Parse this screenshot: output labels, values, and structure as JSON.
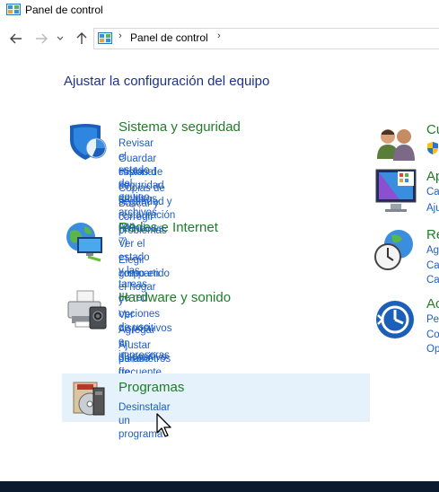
{
  "window": {
    "title": "Panel de control"
  },
  "address_bar": {
    "breadcrumb": "Panel de control"
  },
  "heading": "Ajustar la configuración del equipo",
  "categories": [
    {
      "title": "Sistema y seguridad",
      "links": [
        "Revisar el estado del equipo",
        "Guardar copias de seguridad de los archivos con",
        "Historial de archivos",
        "Copias de seguridad y restauración (Windows 7)",
        "Buscar y corregir problemas"
      ]
    },
    {
      "title": "Redes e Internet",
      "links": [
        "Ver el estado y las tareas de red",
        "Elegir grupo en el hogar y opciones de uso",
        "compartido"
      ]
    },
    {
      "title": "Hardware y sonido",
      "links": [
        "Ver dispositivos e impresoras",
        "Agregar un dispositivo",
        "Ajustar parámetros de configuración de movilidad",
        "de uso frecuente"
      ]
    },
    {
      "title": "Programas",
      "links": [
        "Desinstalar un programa"
      ]
    }
  ],
  "right_categories": [
    {
      "title": "Cu",
      "links": []
    },
    {
      "title": "Ap",
      "links": [
        "Ca",
        "Aju"
      ]
    },
    {
      "title": "Re",
      "links": [
        "Ag",
        "Ca",
        "Ca"
      ]
    },
    {
      "title": "Ac",
      "links": [
        "Pe",
        "Co",
        "Op"
      ]
    }
  ],
  "colors": {
    "heading": "#1e3287",
    "category_title": "#1e7e28",
    "link": "#1e5ec8",
    "hover_highlight": "#e5f1fb"
  },
  "icons": {
    "titlebar": "control-panel-icon",
    "back": "back-arrow-icon",
    "forward": "forward-arrow-icon",
    "recent": "chevron-down-icon",
    "up": "up-arrow-icon",
    "system": "shield-icon",
    "network": "globe-network-icon",
    "hardware": "printer-icon",
    "programs": "programs-box-icon",
    "users": "users-icon",
    "appearance": "monitor-appearance-icon",
    "clock_region": "clock-globe-icon",
    "accessibility": "ease-of-access-icon"
  }
}
